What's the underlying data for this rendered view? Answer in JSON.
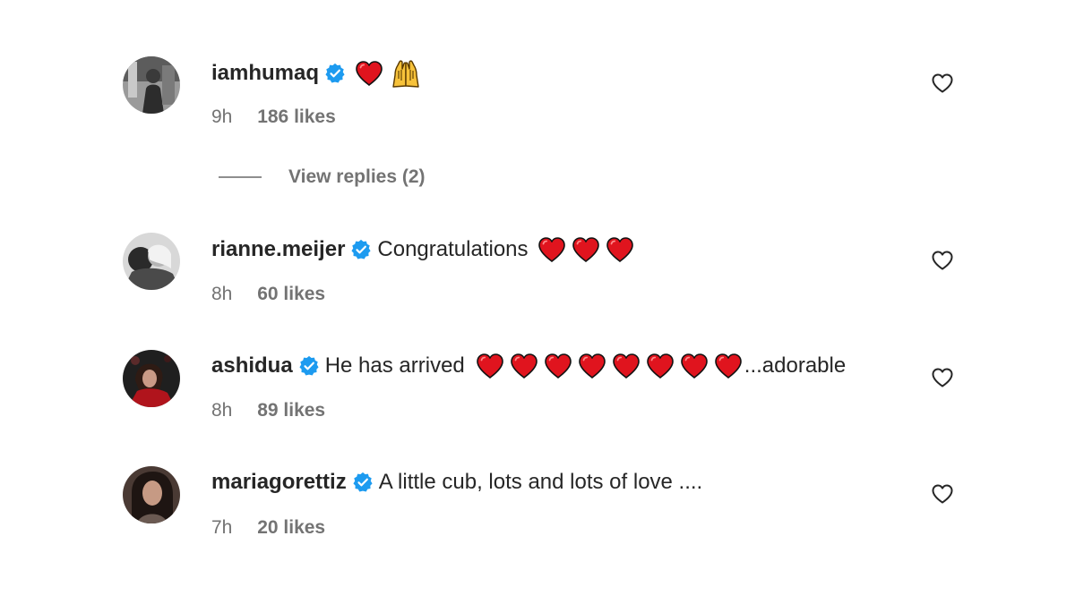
{
  "comments": [
    {
      "username": "iamhumaq",
      "verified": true,
      "text": "",
      "emoji": [
        "red-heart",
        "raising-hands"
      ],
      "time": "9h",
      "likes": "186 likes",
      "view_replies": "View replies (2)"
    },
    {
      "username": "rianne.meijer",
      "verified": true,
      "text": "Congratulations",
      "emoji": [
        "red-heart",
        "red-heart",
        "red-heart"
      ],
      "time": "8h",
      "likes": "60 likes"
    },
    {
      "username": "ashidua",
      "verified": true,
      "text": "He has arrived",
      "emoji": [
        "red-heart",
        "red-heart",
        "red-heart",
        "red-heart",
        "red-heart",
        "red-heart",
        "red-heart",
        "red-heart"
      ],
      "text_after": "...adorable",
      "time": "8h",
      "likes": "89 likes"
    },
    {
      "username": "mariagorettiz",
      "verified": true,
      "text": "A little cub, lots and lots of love ....",
      "emoji": [],
      "time": "7h",
      "likes": "20 likes"
    }
  ],
  "colors": {
    "verified_badge": "#1d9bf0",
    "heart": "#e0141e",
    "muted_text": "#737373",
    "primary_text": "#262626"
  },
  "icons": {
    "verified": "verified-badge-icon",
    "like": "heart-outline-icon"
  }
}
